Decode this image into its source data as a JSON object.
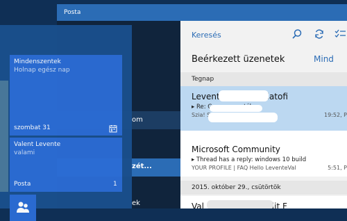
{
  "mail": {
    "window_title": "Posta",
    "search_placeholder": "Keresés",
    "folder_title": "Beérkezett üzenetek",
    "filter_label": "Mind",
    "nav_partial": [
      "om",
      "zét...",
      "ek"
    ],
    "groups": [
      {
        "label": "Tegnap"
      },
      {
        "label": "2015. október 29., csütörtök"
      }
    ],
    "messages": [
      {
        "sender": "Levente Val             giatofi",
        "subject": "Re: Gy                  astély",
        "preview": "Szia! S                     ex.hu c",
        "time": "19:52, P",
        "selected": true
      },
      {
        "sender": "Microsoft Community",
        "subject": "Thread has a reply: windows 10 build",
        "preview": "YOUR PROFILE | FAQ Hello LeventeVal",
        "time": "5:51, P",
        "selected": false
      },
      {
        "sender": "Val                                  redit F",
        "subject": "",
        "preview": "",
        "time": "",
        "selected": false
      }
    ]
  },
  "tiles": {
    "calendar": {
      "title": "Mindenszentek",
      "subtitle": "Holnap egész nap",
      "date": "szombat 31"
    },
    "mail": {
      "sender": "Valent Levente",
      "preview": "valami",
      "label": "Posta",
      "count": "1"
    }
  },
  "icons": [
    "search-icon",
    "sync-icon",
    "select-icon",
    "calendar-icon",
    "people-icon",
    "reply-arrow-icon"
  ],
  "colors": {
    "accent": "#2b6cb5",
    "tile": "#2b6cd4",
    "selected_row": "#bcd8f1"
  }
}
